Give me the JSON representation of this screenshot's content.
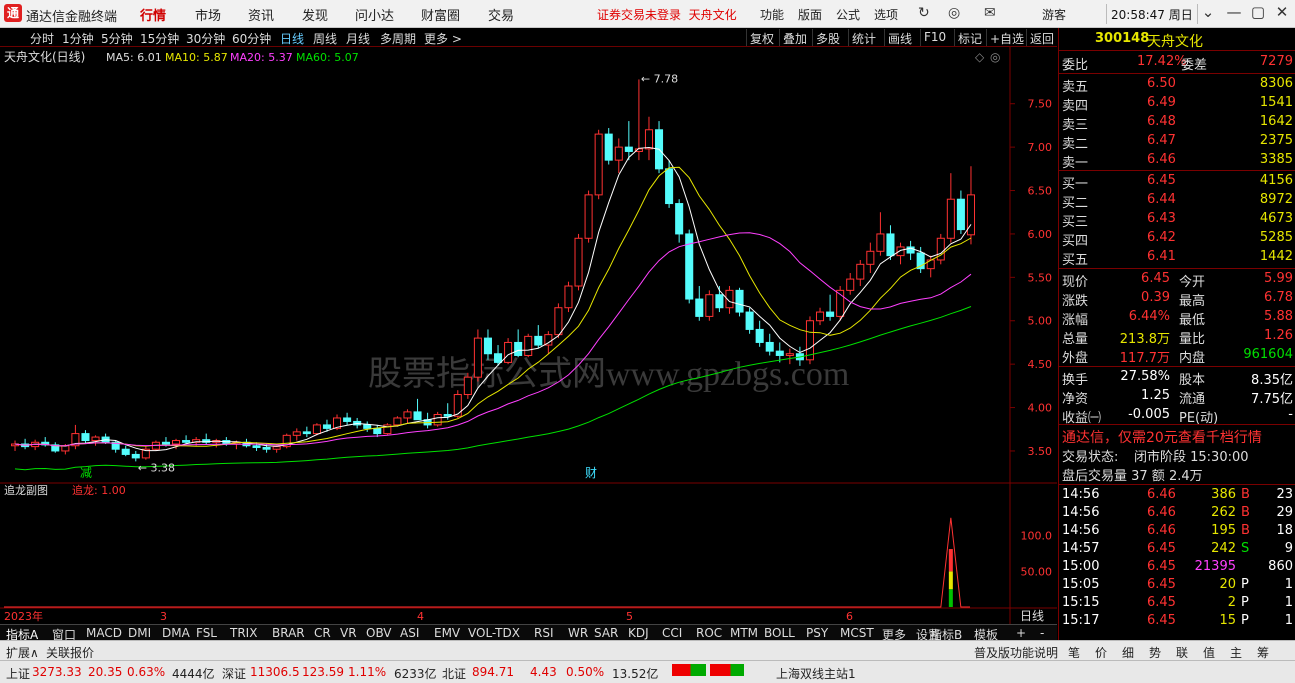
{
  "app": {
    "name": "通达信金融终端",
    "logo": "通"
  },
  "menu": [
    "行情",
    "市场",
    "资讯",
    "发现",
    "问小达",
    "财富圈",
    "交易"
  ],
  "menu_active": 0,
  "warning": "证券交易未登录",
  "stock_short": "天舟文化",
  "top_right": [
    "功能",
    "版面",
    "公式",
    "选项"
  ],
  "guest": "游客",
  "clock": "20:58:47 周日",
  "periods": [
    "分时",
    "1分钟",
    "5分钟",
    "15分钟",
    "30分钟",
    "60分钟",
    "日线",
    "周线",
    "月线",
    "多周期",
    "更多 >"
  ],
  "period_active": 6,
  "toolbar": [
    "复权",
    "叠加",
    "多股",
    "统计",
    "画线",
    "F10",
    "标记",
    "+自选",
    "返回"
  ],
  "chart_header": {
    "title": "天舟文化(日线)",
    "ma5": "MA5: 6.01",
    "ma10": "MA10: 5.87",
    "ma20": "MA20: 5.37",
    "ma60": "MA60: 5.07"
  },
  "watermark": "股票指标公式网www.gpzbgs.com",
  "sub_header": {
    "title": "追龙副图",
    "value_label": "追龙: 1.00"
  },
  "x_axis": {
    "year": "2023年",
    "months": [
      "3",
      "4",
      "5",
      "6"
    ],
    "right_label": "日线"
  },
  "markers": {
    "reduce": "减",
    "finance": "财"
  },
  "chart_data": {
    "type": "candlestick",
    "price_axis": {
      "ticks": [
        "7.50",
        "7.00",
        "6.50",
        "6.00",
        "5.50",
        "5.00",
        "4.50",
        "4.00",
        "3.50"
      ],
      "range": [
        3.2,
        7.9
      ]
    },
    "sub_axis": {
      "ticks": [
        "100.0",
        "50.00"
      ],
      "range": [
        0,
        150
      ]
    },
    "annotations": {
      "high": "7.78",
      "low": "3.38"
    },
    "candles": [
      [
        3.56,
        3.62,
        3.5,
        3.58
      ],
      [
        3.58,
        3.64,
        3.52,
        3.55
      ],
      [
        3.55,
        3.63,
        3.51,
        3.6
      ],
      [
        3.6,
        3.66,
        3.55,
        3.57
      ],
      [
        3.57,
        3.6,
        3.48,
        3.5
      ],
      [
        3.5,
        3.58,
        3.46,
        3.56
      ],
      [
        3.56,
        3.8,
        3.52,
        3.7
      ],
      [
        3.7,
        3.74,
        3.58,
        3.62
      ],
      [
        3.62,
        3.68,
        3.56,
        3.66
      ],
      [
        3.66,
        3.7,
        3.58,
        3.6
      ],
      [
        3.6,
        3.62,
        3.48,
        3.52
      ],
      [
        3.52,
        3.56,
        3.44,
        3.46
      ],
      [
        3.46,
        3.5,
        3.38,
        3.42
      ],
      [
        3.42,
        3.55,
        3.4,
        3.52
      ],
      [
        3.52,
        3.62,
        3.5,
        3.6
      ],
      [
        3.6,
        3.66,
        3.55,
        3.58
      ],
      [
        3.58,
        3.64,
        3.52,
        3.62
      ],
      [
        3.62,
        3.68,
        3.58,
        3.6
      ],
      [
        3.6,
        3.66,
        3.56,
        3.63
      ],
      [
        3.63,
        3.7,
        3.58,
        3.6
      ],
      [
        3.6,
        3.64,
        3.54,
        3.62
      ],
      [
        3.62,
        3.66,
        3.56,
        3.58
      ],
      [
        3.58,
        3.62,
        3.52,
        3.6
      ],
      [
        3.6,
        3.64,
        3.54,
        3.56
      ],
      [
        3.56,
        3.6,
        3.5,
        3.54
      ],
      [
        3.54,
        3.58,
        3.48,
        3.52
      ],
      [
        3.52,
        3.56,
        3.48,
        3.55
      ],
      [
        3.55,
        3.7,
        3.53,
        3.68
      ],
      [
        3.68,
        3.76,
        3.62,
        3.72
      ],
      [
        3.72,
        3.78,
        3.66,
        3.7
      ],
      [
        3.7,
        3.82,
        3.68,
        3.8
      ],
      [
        3.8,
        3.86,
        3.72,
        3.76
      ],
      [
        3.76,
        3.92,
        3.74,
        3.88
      ],
      [
        3.88,
        3.94,
        3.8,
        3.84
      ],
      [
        3.84,
        3.88,
        3.76,
        3.8
      ],
      [
        3.8,
        3.84,
        3.72,
        3.76
      ],
      [
        3.76,
        3.8,
        3.66,
        3.7
      ],
      [
        3.7,
        3.82,
        3.68,
        3.8
      ],
      [
        3.8,
        3.9,
        3.78,
        3.88
      ],
      [
        3.88,
        3.98,
        3.82,
        3.95
      ],
      [
        3.95,
        4.1,
        3.88,
        3.86
      ],
      [
        3.86,
        3.94,
        3.76,
        3.8
      ],
      [
        3.8,
        3.95,
        3.78,
        3.92
      ],
      [
        3.92,
        4.05,
        3.86,
        3.9
      ],
      [
        3.9,
        4.2,
        3.88,
        4.15
      ],
      [
        4.15,
        4.4,
        4.1,
        4.35
      ],
      [
        4.35,
        4.9,
        4.3,
        4.8
      ],
      [
        4.8,
        4.9,
        4.55,
        4.62
      ],
      [
        4.62,
        4.72,
        4.48,
        4.52
      ],
      [
        4.52,
        4.8,
        4.5,
        4.75
      ],
      [
        4.75,
        4.9,
        4.58,
        4.6
      ],
      [
        4.6,
        4.85,
        4.58,
        4.82
      ],
      [
        4.82,
        4.95,
        4.68,
        4.72
      ],
      [
        4.72,
        4.88,
        4.62,
        4.84
      ],
      [
        4.84,
        5.2,
        4.8,
        5.15
      ],
      [
        5.15,
        5.45,
        5.1,
        5.4
      ],
      [
        5.4,
        6.0,
        5.35,
        5.95
      ],
      [
        5.95,
        6.5,
        5.9,
        6.45
      ],
      [
        6.45,
        7.2,
        6.4,
        7.15
      ],
      [
        7.15,
        7.22,
        6.8,
        6.85
      ],
      [
        6.85,
        7.1,
        6.7,
        7.0
      ],
      [
        7.0,
        7.3,
        6.85,
        6.95
      ],
      [
        6.95,
        7.78,
        6.85,
        6.98
      ],
      [
        6.98,
        7.35,
        6.85,
        7.2
      ],
      [
        7.2,
        7.3,
        6.7,
        6.75
      ],
      [
        6.75,
        6.85,
        6.3,
        6.35
      ],
      [
        6.35,
        6.4,
        5.9,
        6.0
      ],
      [
        6.0,
        6.05,
        5.2,
        5.25
      ],
      [
        5.25,
        5.4,
        5.0,
        5.05
      ],
      [
        5.05,
        5.35,
        5.0,
        5.3
      ],
      [
        5.3,
        5.4,
        5.1,
        5.15
      ],
      [
        5.15,
        5.4,
        5.08,
        5.35
      ],
      [
        5.35,
        5.38,
        5.05,
        5.1
      ],
      [
        5.1,
        5.15,
        4.85,
        4.9
      ],
      [
        4.9,
        5.0,
        4.7,
        4.75
      ],
      [
        4.75,
        4.85,
        4.6,
        4.65
      ],
      [
        4.65,
        4.75,
        4.52,
        4.6
      ],
      [
        4.6,
        4.68,
        4.5,
        4.62
      ],
      [
        4.62,
        4.7,
        4.48,
        4.55
      ],
      [
        4.55,
        5.05,
        4.5,
        5.0
      ],
      [
        5.0,
        5.15,
        4.95,
        5.1
      ],
      [
        5.1,
        5.3,
        5.0,
        5.05
      ],
      [
        5.05,
        5.4,
        5.0,
        5.35
      ],
      [
        5.35,
        5.55,
        5.3,
        5.48
      ],
      [
        5.48,
        5.7,
        5.4,
        5.65
      ],
      [
        5.65,
        5.9,
        5.55,
        5.8
      ],
      [
        5.8,
        6.25,
        5.75,
        6.0
      ],
      [
        6.0,
        6.1,
        5.7,
        5.75
      ],
      [
        5.75,
        5.9,
        5.65,
        5.85
      ],
      [
        5.85,
        5.92,
        5.7,
        5.78
      ],
      [
        5.78,
        5.85,
        5.55,
        5.6
      ],
      [
        5.6,
        5.75,
        5.5,
        5.7
      ],
      [
        5.7,
        6.0,
        5.65,
        5.95
      ],
      [
        5.95,
        6.7,
        5.9,
        6.4
      ],
      [
        6.4,
        6.5,
        6.0,
        6.05
      ],
      [
        5.99,
        6.78,
        5.88,
        6.45
      ]
    ],
    "ma5_end": 6.01,
    "ma10_end": 5.87,
    "ma20_end": 5.37,
    "ma60_end": 5.07,
    "sub_series": {
      "name": "追龙",
      "spike_value": 125,
      "spike_index": 93
    }
  },
  "quote": {
    "code": "300148",
    "name": "天舟文化",
    "weibi_label": "委比",
    "weibi": "17.42%",
    "weicha_label": "委差",
    "weicha": "7279",
    "asks": [
      {
        "label": "卖五",
        "price": "6.50",
        "vol": "8306"
      },
      {
        "label": "卖四",
        "price": "6.49",
        "vol": "1541"
      },
      {
        "label": "卖三",
        "price": "6.48",
        "vol": "1642"
      },
      {
        "label": "卖二",
        "price": "6.47",
        "vol": "2375"
      },
      {
        "label": "卖一",
        "price": "6.46",
        "vol": "3385"
      }
    ],
    "bids": [
      {
        "label": "买一",
        "price": "6.45",
        "vol": "4156"
      },
      {
        "label": "买二",
        "price": "6.44",
        "vol": "8972"
      },
      {
        "label": "买三",
        "price": "6.43",
        "vol": "4673"
      },
      {
        "label": "买四",
        "price": "6.42",
        "vol": "5285"
      },
      {
        "label": "买五",
        "price": "6.41",
        "vol": "1442"
      }
    ],
    "stats": [
      {
        "l1": "现价",
        "v1": "6.45",
        "c1": "red",
        "l2": "今开",
        "v2": "5.99",
        "c2": "red"
      },
      {
        "l1": "涨跌",
        "v1": "0.39",
        "c1": "red",
        "l2": "最高",
        "v2": "6.78",
        "c2": "red"
      },
      {
        "l1": "涨幅",
        "v1": "6.44%",
        "c1": "red",
        "l2": "最低",
        "v2": "5.88",
        "c2": "red"
      },
      {
        "l1": "总量",
        "v1": "213.8万",
        "c1": "yellow",
        "l2": "量比",
        "v2": "1.26",
        "c2": "red"
      },
      {
        "l1": "外盘",
        "v1": "117.7万",
        "c1": "red",
        "l2": "内盘",
        "v2": "961604",
        "c2": "green"
      }
    ],
    "stats2": [
      {
        "l1": "换手",
        "v1": "27.58%",
        "l2": "股本",
        "v2": "8.35亿"
      },
      {
        "l1": "净资",
        "v1": "1.25",
        "l2": "流通",
        "v2": "7.75亿"
      },
      {
        "l1": "收益㈠",
        "v1": "-0.005",
        "l2": "PE(动)",
        "v2": "-"
      }
    ],
    "promo": "通达信，仅需20元查看千档行情",
    "trade_status_label": "交易状态:",
    "trade_status": "闭市阶段 15:30:00",
    "after_hours": "盘后交易量 37 额 2.4万",
    "ticks": [
      {
        "t": "14:56",
        "p": "6.46",
        "v": "386",
        "d": "B",
        "n": "23",
        "vc": "yellow"
      },
      {
        "t": "14:56",
        "p": "6.46",
        "v": "262",
        "d": "B",
        "n": "29",
        "vc": "yellow"
      },
      {
        "t": "14:56",
        "p": "6.46",
        "v": "195",
        "d": "B",
        "n": "18",
        "vc": "yellow"
      },
      {
        "t": "14:57",
        "p": "6.45",
        "v": "242",
        "d": "S",
        "n": "9",
        "vc": "yellow"
      },
      {
        "t": "15:00",
        "p": "6.45",
        "v": "21395",
        "d": "",
        "n": "860",
        "vc": "magenta"
      },
      {
        "t": "15:05",
        "p": "6.45",
        "v": "20",
        "d": "P",
        "n": "1",
        "vc": "yellow"
      },
      {
        "t": "15:15",
        "p": "6.45",
        "v": "2",
        "d": "P",
        "n": "1",
        "vc": "yellow"
      },
      {
        "t": "15:17",
        "p": "6.45",
        "v": "15",
        "d": "P",
        "n": "1",
        "vc": "yellow"
      }
    ]
  },
  "indicators": [
    "指标A",
    "窗口",
    "MACD",
    "DMI",
    "DMA",
    "FSL",
    "TRIX",
    "BRAR",
    "CR",
    "VR",
    "OBV",
    "ASI",
    "EMV",
    "VOL-TDX",
    "RSI",
    "WR",
    "SAR",
    "KDJ",
    "CCI",
    "ROC",
    "MTM",
    "BOLL",
    "PSY",
    "MCST",
    "更多",
    "设置"
  ],
  "indicator_right": [
    "指标B",
    "模板",
    "+",
    "-"
  ],
  "ext_bar": {
    "left1": "扩展∧",
    "left2": "关联报价",
    "right": "普及版功能说明",
    "tabs": [
      "笔",
      "价",
      "细",
      "势",
      "联",
      "值",
      "主",
      "筹"
    ]
  },
  "status": {
    "sh_label": "上证",
    "sh": "3273.33",
    "sh_chg": "20.35",
    "sh_pct": "0.63%",
    "sh_amt": "4444亿",
    "sz_label": "深证",
    "sz": "11306.5",
    "sz_chg": "123.59",
    "sz_pct": "1.11%",
    "sz_amt": "6233亿",
    "bz_label": "北证",
    "bz": "894.71",
    "bz_chg": "4.43",
    "bz_pct": "0.50%",
    "bz_amt": "13.52亿",
    "server": "上海双线主站1"
  }
}
